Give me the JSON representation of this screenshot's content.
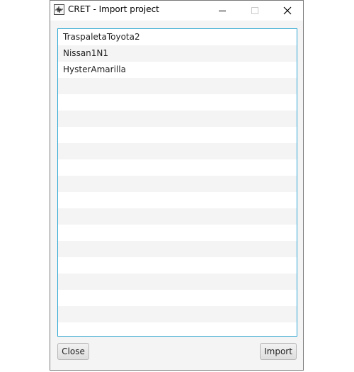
{
  "window": {
    "title": "CRET - Import project",
    "icon": "waveform-icon",
    "controls": {
      "minimize": "minimize-icon",
      "maximize": "maximize-icon",
      "close": "close-icon"
    }
  },
  "projects": {
    "items": [
      "TraspaletaToyota2",
      "Nissan1N1",
      "HysterAmarilla"
    ]
  },
  "footer": {
    "close_label": "Close",
    "import_label": "Import"
  },
  "colors": {
    "list_border": "#2ea6d1",
    "row_alt": "#f4f4f4",
    "window_bg": "#f4f4f4"
  }
}
